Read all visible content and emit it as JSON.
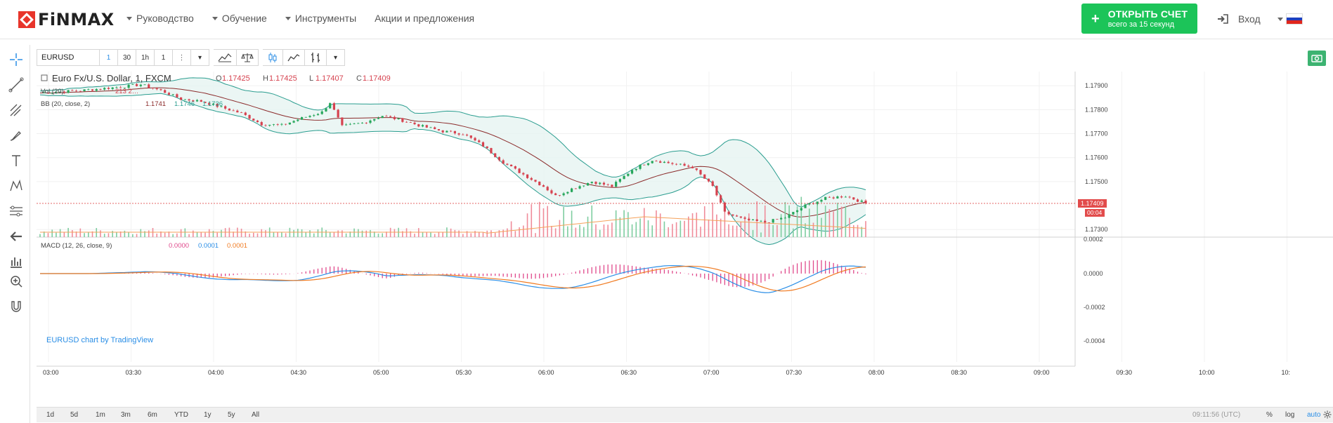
{
  "header": {
    "logo": "FiNMAX",
    "nav": [
      "Руководство",
      "Обучение",
      "Инструменты",
      "Акции и предложения"
    ],
    "nav_has_caret": [
      true,
      true,
      true,
      false
    ],
    "cta_main": "ОТКРЫТЬ СЧЕТ",
    "cta_sub": "всего за 15 секунд",
    "login": "Вход",
    "colors": {
      "cta": "#1cc459",
      "logo": "#e8352b"
    }
  },
  "toolbar": {
    "symbol": "EURUSD",
    "intervals": [
      "1",
      "30",
      "1h",
      "1"
    ],
    "active_interval": "1"
  },
  "legend": {
    "title": "Euro Fx/U.S. Dollar, 1, FXCM",
    "o_label": "O",
    "o": "1.17425",
    "h_label": "H",
    "h": "1.17425",
    "l_label": "L",
    "l": "1.17407",
    "c_label": "C",
    "c": "1.17409",
    "vol": "Vol (20)",
    "vol_vals": "213  2…",
    "bb": "BB (20, close, 2)",
    "bb_1": "1.1741",
    "bb_2": "1.1746",
    "bb_3": "1.1736",
    "macd": "MACD (12, 26, close, 9)",
    "macd_1": "0.0000",
    "macd_2": "0.0001",
    "macd_3": "0.0001"
  },
  "chart_data": {
    "type": "line",
    "title": "Euro Fx/U.S. Dollar, 1, FXCM",
    "price_ticks": [
      "1.17900",
      "1.17800",
      "1.17700",
      "1.17600",
      "1.17500",
      "1.17300"
    ],
    "price_range": [
      1.1728,
      1.1793
    ],
    "last_price": "1.17409",
    "countdown": "00:04",
    "macd_ticks": [
      "0.0002",
      "0.0000",
      "-0.0002",
      "-0.0004"
    ],
    "time_ticks": [
      "03:00",
      "03:30",
      "04:00",
      "04:30",
      "05:00",
      "05:30",
      "06:00",
      "06:30",
      "07:00",
      "07:30",
      "08:00",
      "08:30",
      "09:00",
      "09:30",
      "10:00",
      "10:"
    ],
    "close_series_keypoints": [
      [
        0,
        1.1787
      ],
      [
        10,
        1.1788
      ],
      [
        20,
        1.17895
      ],
      [
        25,
        1.17905
      ],
      [
        30,
        1.1788
      ],
      [
        35,
        1.17845
      ],
      [
        40,
        1.17835
      ],
      [
        45,
        1.1781
      ],
      [
        50,
        1.17785
      ],
      [
        55,
        1.1774
      ],
      [
        60,
        1.17735
      ],
      [
        65,
        1.17765
      ],
      [
        70,
        1.1779
      ],
      [
        72,
        1.1783
      ],
      [
        75,
        1.1773
      ],
      [
        80,
        1.17745
      ],
      [
        85,
        1.17775
      ],
      [
        90,
        1.17755
      ],
      [
        95,
        1.1773
      ],
      [
        100,
        1.1771
      ],
      [
        105,
        1.177
      ],
      [
        110,
        1.1765
      ],
      [
        115,
        1.1758
      ],
      [
        120,
        1.1753
      ],
      [
        125,
        1.1748
      ],
      [
        128,
        1.1744
      ],
      [
        132,
        1.1747
      ],
      [
        137,
        1.175
      ],
      [
        142,
        1.1748
      ],
      [
        147,
        1.1755
      ],
      [
        152,
        1.1759
      ],
      [
        157,
        1.17575
      ],
      [
        162,
        1.1756
      ],
      [
        167,
        1.1748
      ],
      [
        170,
        1.1737
      ],
      [
        175,
        1.1734
      ],
      [
        180,
        1.1733
      ],
      [
        185,
        1.1735
      ],
      [
        190,
        1.174
      ],
      [
        195,
        1.1743
      ],
      [
        200,
        1.1744
      ],
      [
        205,
        1.17409
      ]
    ],
    "watermark": "EURUSD chart by TradingView"
  },
  "bottom": {
    "periods": [
      "1d",
      "5d",
      "1m",
      "3m",
      "6m",
      "YTD",
      "1y",
      "5y",
      "All"
    ],
    "time": "09:11:56 (UTC)",
    "pct": "%",
    "log": "log",
    "auto": "auto"
  }
}
